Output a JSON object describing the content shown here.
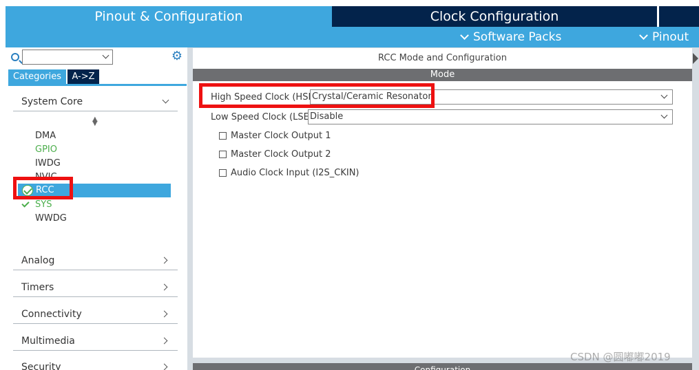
{
  "tabs": {
    "pinout_config": "Pinout & Configuration",
    "clock_config": "Clock Configuration"
  },
  "subbar": {
    "software_packs": "Software Packs",
    "pinout": "Pinout"
  },
  "sidebar": {
    "search_value": "",
    "tab_categories": "Categories",
    "tab_az": "A->Z",
    "system_core": {
      "label": "System Core",
      "items": [
        {
          "label": "DMA",
          "status": "none"
        },
        {
          "label": "GPIO",
          "status": "configured"
        },
        {
          "label": "IWDG",
          "status": "none"
        },
        {
          "label": "NVIC",
          "status": "none"
        },
        {
          "label": "RCC",
          "status": "selected-ok"
        },
        {
          "label": "SYS",
          "status": "ok"
        },
        {
          "label": "WWDG",
          "status": "none"
        }
      ]
    },
    "categories": [
      "Analog",
      "Timers",
      "Connectivity",
      "Multimedia",
      "Security"
    ]
  },
  "main": {
    "title": "RCC Mode and Configuration",
    "mode_header": "Mode",
    "hse": {
      "label": "High Speed Clock (HSE)",
      "value": "Crystal/Ceramic Resonator"
    },
    "lse": {
      "label": "Low Speed Clock (LSE)",
      "value": "Disable"
    },
    "checkboxes": [
      {
        "label": "Master Clock Output 1",
        "checked": false
      },
      {
        "label": "Master Clock Output 2",
        "checked": false
      },
      {
        "label": "Audio Clock Input (I2S_CKIN)",
        "checked": false
      }
    ],
    "config_header": "Configuration"
  },
  "watermark": "CSDN @圆嘟嘟2019",
  "colors": {
    "accent_blue": "#3ea7de",
    "dark_navy": "#03234b",
    "ok_green": "#4cae4c",
    "highlight_red": "#ee1111",
    "header_gray": "#6d6e71"
  }
}
